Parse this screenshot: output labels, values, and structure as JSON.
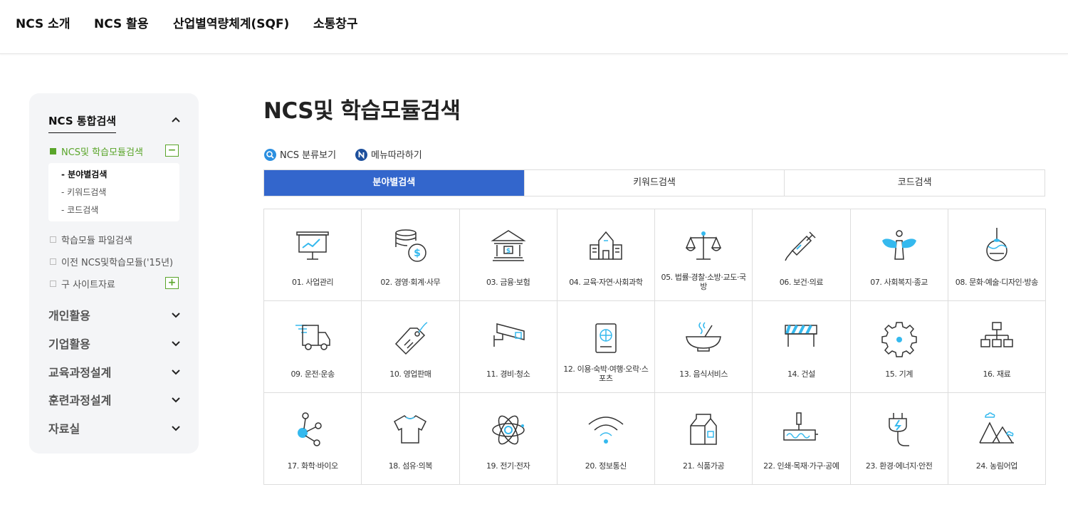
{
  "topnav": {
    "items": [
      "NCS 소개",
      "NCS 활용",
      "산업별역량체계(SQF)",
      "소통창구"
    ]
  },
  "sidebar": {
    "title": "NCS 통합검색",
    "active_menu": "NCS및 학습모듈검색",
    "active_toggle": "−",
    "sub_items": [
      "- 분야별검색",
      "- 키워드검색",
      "- 코드검색"
    ],
    "menu_items": [
      "학습모듈 파일검색",
      "이전 NCS및학습모듈('15년)",
      "구 사이트자료"
    ],
    "expand_toggle": "+",
    "groups": [
      "개인활용",
      "기업활용",
      "교육과정설계",
      "훈련과정설계",
      "자료실"
    ]
  },
  "main": {
    "title": "NCS및 학습모듈검색",
    "links": [
      "NCS 분류보기",
      "메뉴따라하기"
    ],
    "tabs": [
      "분야별검색",
      "키워드검색",
      "코드검색"
    ],
    "active_tab": 0,
    "categories": [
      {
        "label": "01. 사업관리",
        "icon": "presentation-board-icon"
      },
      {
        "label": "02. 경영·회계·사무",
        "icon": "coins-money-icon"
      },
      {
        "label": "03. 금융·보험",
        "icon": "bank-icon"
      },
      {
        "label": "04. 교육·자연·사회과학",
        "icon": "school-building-icon"
      },
      {
        "label": "05. 법률·경찰·소방·교도·국방",
        "icon": "scales-icon"
      },
      {
        "label": "06. 보건·의료",
        "icon": "syringe-icon"
      },
      {
        "label": "07. 사회복지·종교",
        "icon": "angel-icon"
      },
      {
        "label": "08. 문화·예술·디자인·방송",
        "icon": "ornament-icon"
      },
      {
        "label": "09. 운전·운송",
        "icon": "truck-icon"
      },
      {
        "label": "10. 영업판매",
        "icon": "price-tag-icon"
      },
      {
        "label": "11. 경비·청소",
        "icon": "cctv-camera-icon"
      },
      {
        "label": "12. 이용·숙박·여행·오락·스포츠",
        "icon": "passport-icon"
      },
      {
        "label": "13. 음식서비스",
        "icon": "food-bowl-icon"
      },
      {
        "label": "14. 건설",
        "icon": "construction-barrier-icon"
      },
      {
        "label": "15. 기계",
        "icon": "gear-icon"
      },
      {
        "label": "16. 재료",
        "icon": "hierarchy-icon"
      },
      {
        "label": "17. 화학·바이오",
        "icon": "molecule-icon"
      },
      {
        "label": "18. 섬유·의복",
        "icon": "t-shirt-icon"
      },
      {
        "label": "19. 전기·전자",
        "icon": "atom-icon"
      },
      {
        "label": "20. 정보통신",
        "icon": "wifi-icon"
      },
      {
        "label": "21. 식품가공",
        "icon": "milk-carton-icon"
      },
      {
        "label": "22. 인쇄·목재·가구·공예",
        "icon": "paint-roller-icon"
      },
      {
        "label": "23. 환경·에너지·안전",
        "icon": "power-plug-icon"
      },
      {
        "label": "24. 농림어업",
        "icon": "mountains-icon"
      }
    ]
  },
  "colors": {
    "accent_blue": "#3366cc",
    "accent_green": "#5aa52a",
    "icon_cyan": "#35b9ee"
  }
}
